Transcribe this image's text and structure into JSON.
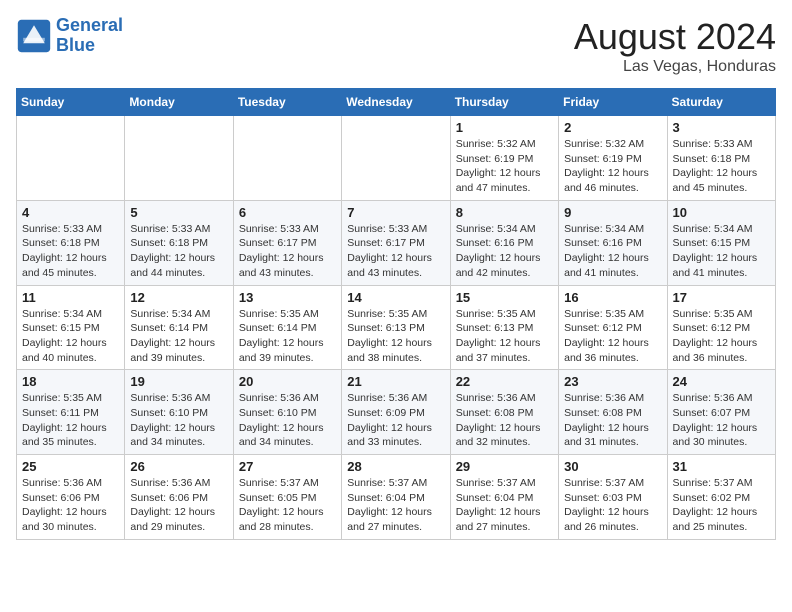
{
  "header": {
    "logo_line1": "General",
    "logo_line2": "Blue",
    "month_year": "August 2024",
    "location": "Las Vegas, Honduras"
  },
  "days_of_week": [
    "Sunday",
    "Monday",
    "Tuesday",
    "Wednesday",
    "Thursday",
    "Friday",
    "Saturday"
  ],
  "weeks": [
    [
      {
        "day": "",
        "info": ""
      },
      {
        "day": "",
        "info": ""
      },
      {
        "day": "",
        "info": ""
      },
      {
        "day": "",
        "info": ""
      },
      {
        "day": "1",
        "info": "Sunrise: 5:32 AM\nSunset: 6:19 PM\nDaylight: 12 hours\nand 47 minutes."
      },
      {
        "day": "2",
        "info": "Sunrise: 5:32 AM\nSunset: 6:19 PM\nDaylight: 12 hours\nand 46 minutes."
      },
      {
        "day": "3",
        "info": "Sunrise: 5:33 AM\nSunset: 6:18 PM\nDaylight: 12 hours\nand 45 minutes."
      }
    ],
    [
      {
        "day": "4",
        "info": "Sunrise: 5:33 AM\nSunset: 6:18 PM\nDaylight: 12 hours\nand 45 minutes."
      },
      {
        "day": "5",
        "info": "Sunrise: 5:33 AM\nSunset: 6:18 PM\nDaylight: 12 hours\nand 44 minutes."
      },
      {
        "day": "6",
        "info": "Sunrise: 5:33 AM\nSunset: 6:17 PM\nDaylight: 12 hours\nand 43 minutes."
      },
      {
        "day": "7",
        "info": "Sunrise: 5:33 AM\nSunset: 6:17 PM\nDaylight: 12 hours\nand 43 minutes."
      },
      {
        "day": "8",
        "info": "Sunrise: 5:34 AM\nSunset: 6:16 PM\nDaylight: 12 hours\nand 42 minutes."
      },
      {
        "day": "9",
        "info": "Sunrise: 5:34 AM\nSunset: 6:16 PM\nDaylight: 12 hours\nand 41 minutes."
      },
      {
        "day": "10",
        "info": "Sunrise: 5:34 AM\nSunset: 6:15 PM\nDaylight: 12 hours\nand 41 minutes."
      }
    ],
    [
      {
        "day": "11",
        "info": "Sunrise: 5:34 AM\nSunset: 6:15 PM\nDaylight: 12 hours\nand 40 minutes."
      },
      {
        "day": "12",
        "info": "Sunrise: 5:34 AM\nSunset: 6:14 PM\nDaylight: 12 hours\nand 39 minutes."
      },
      {
        "day": "13",
        "info": "Sunrise: 5:35 AM\nSunset: 6:14 PM\nDaylight: 12 hours\nand 39 minutes."
      },
      {
        "day": "14",
        "info": "Sunrise: 5:35 AM\nSunset: 6:13 PM\nDaylight: 12 hours\nand 38 minutes."
      },
      {
        "day": "15",
        "info": "Sunrise: 5:35 AM\nSunset: 6:13 PM\nDaylight: 12 hours\nand 37 minutes."
      },
      {
        "day": "16",
        "info": "Sunrise: 5:35 AM\nSunset: 6:12 PM\nDaylight: 12 hours\nand 36 minutes."
      },
      {
        "day": "17",
        "info": "Sunrise: 5:35 AM\nSunset: 6:12 PM\nDaylight: 12 hours\nand 36 minutes."
      }
    ],
    [
      {
        "day": "18",
        "info": "Sunrise: 5:35 AM\nSunset: 6:11 PM\nDaylight: 12 hours\nand 35 minutes."
      },
      {
        "day": "19",
        "info": "Sunrise: 5:36 AM\nSunset: 6:10 PM\nDaylight: 12 hours\nand 34 minutes."
      },
      {
        "day": "20",
        "info": "Sunrise: 5:36 AM\nSunset: 6:10 PM\nDaylight: 12 hours\nand 34 minutes."
      },
      {
        "day": "21",
        "info": "Sunrise: 5:36 AM\nSunset: 6:09 PM\nDaylight: 12 hours\nand 33 minutes."
      },
      {
        "day": "22",
        "info": "Sunrise: 5:36 AM\nSunset: 6:08 PM\nDaylight: 12 hours\nand 32 minutes."
      },
      {
        "day": "23",
        "info": "Sunrise: 5:36 AM\nSunset: 6:08 PM\nDaylight: 12 hours\nand 31 minutes."
      },
      {
        "day": "24",
        "info": "Sunrise: 5:36 AM\nSunset: 6:07 PM\nDaylight: 12 hours\nand 30 minutes."
      }
    ],
    [
      {
        "day": "25",
        "info": "Sunrise: 5:36 AM\nSunset: 6:06 PM\nDaylight: 12 hours\nand 30 minutes."
      },
      {
        "day": "26",
        "info": "Sunrise: 5:36 AM\nSunset: 6:06 PM\nDaylight: 12 hours\nand 29 minutes."
      },
      {
        "day": "27",
        "info": "Sunrise: 5:37 AM\nSunset: 6:05 PM\nDaylight: 12 hours\nand 28 minutes."
      },
      {
        "day": "28",
        "info": "Sunrise: 5:37 AM\nSunset: 6:04 PM\nDaylight: 12 hours\nand 27 minutes."
      },
      {
        "day": "29",
        "info": "Sunrise: 5:37 AM\nSunset: 6:04 PM\nDaylight: 12 hours\nand 27 minutes."
      },
      {
        "day": "30",
        "info": "Sunrise: 5:37 AM\nSunset: 6:03 PM\nDaylight: 12 hours\nand 26 minutes."
      },
      {
        "day": "31",
        "info": "Sunrise: 5:37 AM\nSunset: 6:02 PM\nDaylight: 12 hours\nand 25 minutes."
      }
    ]
  ]
}
